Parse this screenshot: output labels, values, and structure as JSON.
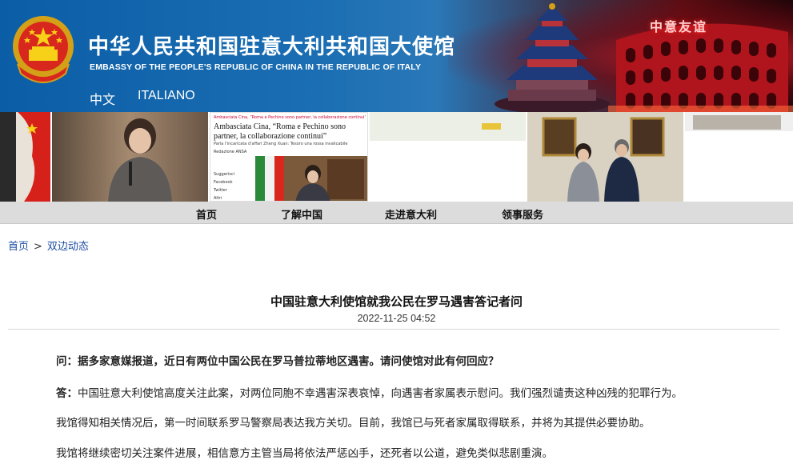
{
  "header": {
    "title_cn": "中华人民共和国驻意大利共和国大使馆",
    "title_en": "EMBASSY OF THE PEOPLE'S REPUBLIC OF CHINA IN THE REPUBLIC OF ITALY",
    "badge_text": "中意友谊",
    "languages": [
      {
        "label": "中文"
      },
      {
        "label": "ITALIANO"
      }
    ]
  },
  "photo_strip": {
    "news_clip": {
      "site": "Ambasciata Cina, “Roma e Pechino sono partner, la collaborazione continui”",
      "headline": "Ambasciata Cina, “Roma e Pechino sono partner, la collaborazione continui”",
      "byline": "Parla l'incaricata d'affari Zheng Xuan: Tesoro una rossa invalicabile",
      "source": "Redazione ANSA",
      "share_items": [
        "Suggerisci",
        "Facebook",
        "Twitter",
        "Altri"
      ]
    }
  },
  "nav": {
    "items": [
      {
        "label": "首页"
      },
      {
        "label": "了解中国"
      },
      {
        "label": "走进意大利"
      },
      {
        "label": "领事服务"
      }
    ]
  },
  "breadcrumb": {
    "home": "首页",
    "separator": ">",
    "current": "双边动态"
  },
  "article": {
    "title": "中国驻意大利使馆就我公民在罗马遇害答记者问",
    "date": "2022-11-25 04:52",
    "q_label": "问：",
    "q_text": "据多家意媒报道，近日有两位中国公民在罗马普拉蒂地区遇害。请问使馆对此有何回应？",
    "a_label": "答：",
    "a_text": "中国驻意大利使馆高度关注此案，对两位同胞不幸遇害深表哀悼，向遇害者家属表示慰问。我们强烈谴责这种凶残的犯罪行为。",
    "p2": "我馆得知相关情况后，第一时间联系罗马警察局表达我方关切。目前，我馆已与死者家属取得联系，并将为其提供必要协助。",
    "p3": "我馆将继续密切关注案件进展，相信意方主管当局将依法严惩凶手，还死者以公道，避免类似悲剧重演。"
  },
  "colors": {
    "header_blue": "#0b5ea6",
    "header_red": "#c8161e",
    "nav_gray": "#dcdcdc",
    "link_blue": "#1f4fa3"
  }
}
